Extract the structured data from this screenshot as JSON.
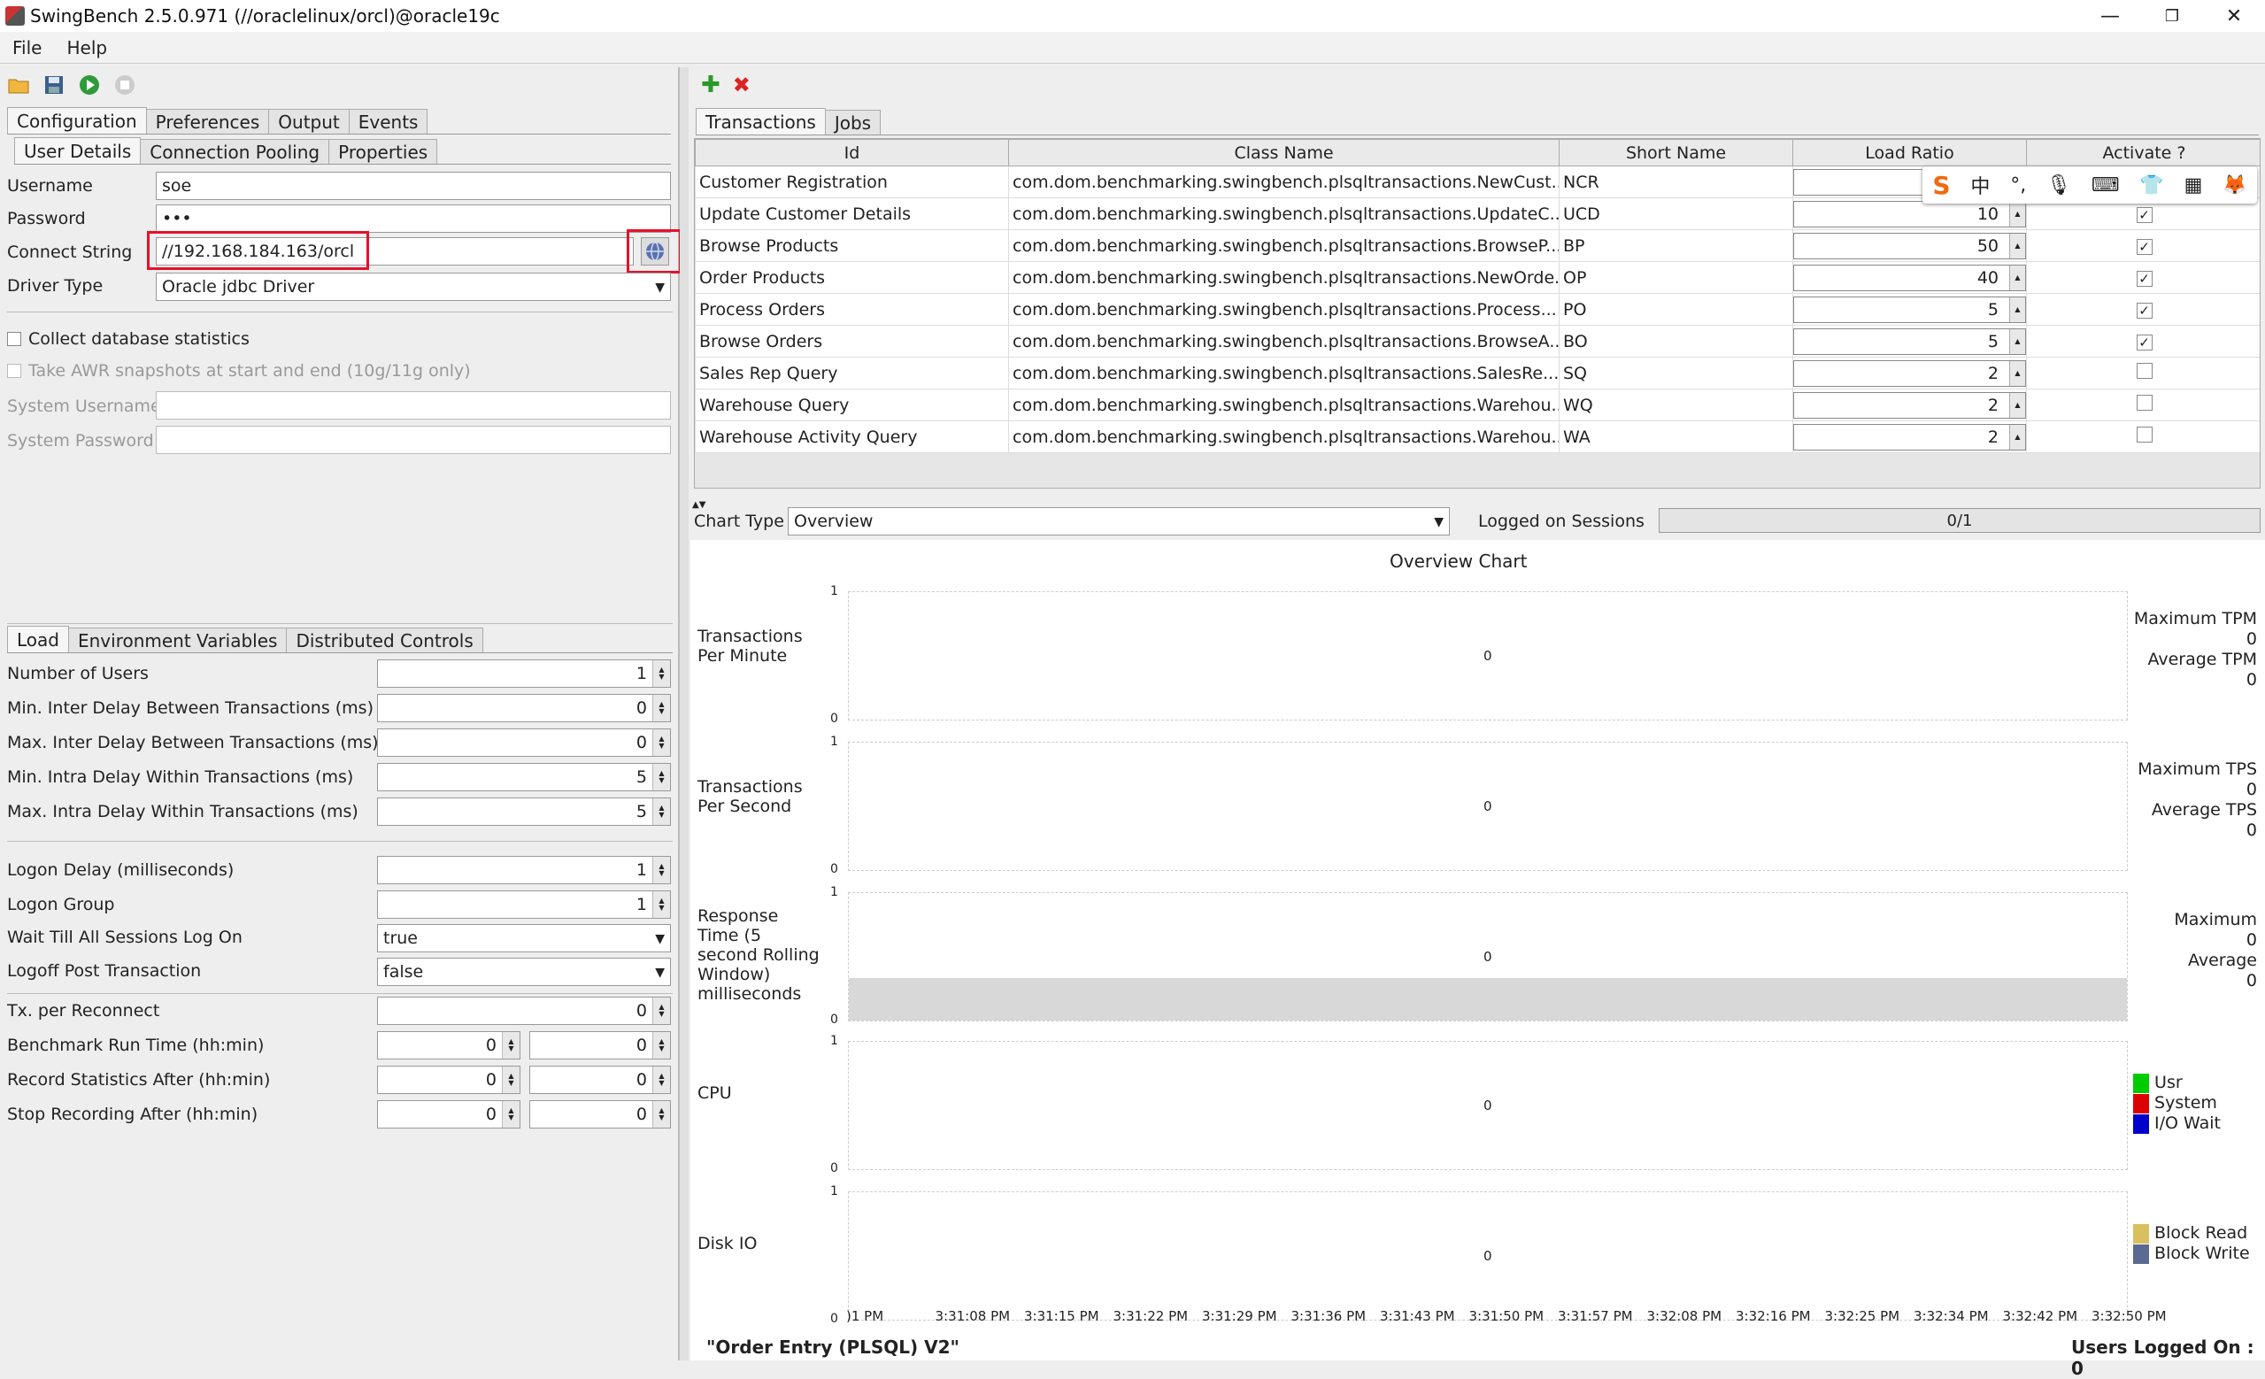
{
  "window": {
    "title": "SwingBench 2.5.0.971  (//oraclelinux/orcl)@oracle19c",
    "minimize": "—",
    "restore": "❐",
    "close": "✕"
  },
  "menu": [
    "File",
    "Help"
  ],
  "left": {
    "tabs": [
      "Configuration",
      "Preferences",
      "Output",
      "Events"
    ],
    "subtabs": [
      "User Details",
      "Connection Pooling",
      "Properties"
    ],
    "username_label": "Username",
    "username": "soe",
    "password_label": "Password",
    "password": "•••",
    "connect_label": "Connect String",
    "connect": "//192.168.184.163/orcl",
    "driver_label": "Driver Type",
    "driver": "Oracle jdbc Driver",
    "collect_stats": "Collect database statistics",
    "awr": "Take AWR snapshots at start and end (10g/11g only)",
    "sys_user": "System Username",
    "sys_pass": "System Password",
    "load_tabs": [
      "Load",
      "Environment Variables",
      "Distributed Controls"
    ],
    "load": [
      {
        "label": "Number of Users",
        "value": "1"
      },
      {
        "label": "Min. Inter Delay Between Transactions (ms)",
        "value": "0"
      },
      {
        "label": "Max. Inter Delay Between Transactions (ms)",
        "value": "0"
      },
      {
        "label": "Min. Intra Delay Within Transactions (ms)",
        "value": "5"
      },
      {
        "label": "Max. Intra Delay Within Transactions (ms)",
        "value": "5"
      }
    ],
    "logon_delay_label": "Logon Delay (milliseconds)",
    "logon_delay": "1",
    "logon_group_label": "Logon Group",
    "logon_group": "1",
    "wait_label": "Wait Till All Sessions Log On",
    "wait": "true",
    "logoff_label": "Logoff Post Transaction",
    "logoff": "false",
    "tx_label": "Tx. per Reconnect",
    "tx": "0",
    "run_label": "Benchmark Run Time (hh:min)",
    "run_h": "0",
    "run_m": "0",
    "rec_label": "Record Statistics After (hh:min)",
    "rec_h": "0",
    "rec_m": "0",
    "stop_label": "Stop Recording After (hh:min)",
    "stop_h": "0",
    "stop_m": "0"
  },
  "right": {
    "tabs": [
      "Transactions",
      "Jobs"
    ],
    "columns": [
      "Id",
      "Class Name",
      "Short Name",
      "Load Ratio",
      "Activate ?"
    ],
    "rows": [
      {
        "id": "Customer Registration",
        "cls": "com.dom.benchmarking.swingbench.plsqltransactions.NewCust...",
        "short": "NCR",
        "ratio": "",
        "active": true
      },
      {
        "id": "Update Customer Details",
        "cls": "com.dom.benchmarking.swingbench.plsqltransactions.UpdateC...",
        "short": "UCD",
        "ratio": "10",
        "active": true
      },
      {
        "id": "Browse Products",
        "cls": "com.dom.benchmarking.swingbench.plsqltransactions.BrowseP...",
        "short": "BP",
        "ratio": "50",
        "active": true
      },
      {
        "id": "Order Products",
        "cls": "com.dom.benchmarking.swingbench.plsqltransactions.NewOrde...",
        "short": "OP",
        "ratio": "40",
        "active": true
      },
      {
        "id": "Process Orders",
        "cls": "com.dom.benchmarking.swingbench.plsqltransactions.Process...",
        "short": "PO",
        "ratio": "5",
        "active": true
      },
      {
        "id": "Browse Orders",
        "cls": "com.dom.benchmarking.swingbench.plsqltransactions.BrowseA...",
        "short": "BO",
        "ratio": "5",
        "active": true
      },
      {
        "id": "Sales Rep Query",
        "cls": "com.dom.benchmarking.swingbench.plsqltransactions.SalesRe...",
        "short": "SQ",
        "ratio": "2",
        "active": false
      },
      {
        "id": "Warehouse Query",
        "cls": "com.dom.benchmarking.swingbench.plsqltransactions.Warehou...",
        "short": "WQ",
        "ratio": "2",
        "active": false
      },
      {
        "id": "Warehouse Activity Query",
        "cls": "com.dom.benchmarking.swingbench.plsqltransactions.Warehou...",
        "short": "WA",
        "ratio": "2",
        "active": false
      }
    ],
    "chart_type_label": "Chart Type",
    "chart_type": "Overview",
    "sessions_label": "Logged on Sessions",
    "sessions": "0/1",
    "chart_title": "Overview Chart",
    "charts": [
      {
        "label": "Transactions\nPer Minute",
        "s1": "Maximum TPM",
        "v1": "0",
        "s2": "Average TPM",
        "v2": "0"
      },
      {
        "label": "Transactions\nPer Second",
        "s1": "Maximum TPS",
        "v1": "0",
        "s2": "Average TPS",
        "v2": "0"
      },
      {
        "label": "Response\nTime (5\nsecond Rolling\nWindow)\nmilliseconds",
        "s1": "Maximum",
        "v1": "0",
        "s2": "Average",
        "v2": "0"
      },
      {
        "label": "CPU",
        "legend": [
          "Usr",
          "System",
          "I/O Wait"
        ]
      },
      {
        "label": "Disk IO",
        "legend": [
          "Block Read",
          "Block Write"
        ]
      }
    ],
    "times": [
      ")1 PM",
      "3:31:08 PM",
      "3:31:15 PM",
      "3:31:22 PM",
      "3:31:29 PM",
      "3:31:36 PM",
      "3:31:43 PM",
      "3:31:50 PM",
      "3:31:57 PM",
      "3:32:08 PM",
      "3:32:16 PM",
      "3:32:25 PM",
      "3:32:34 PM",
      "3:32:42 PM",
      "3:32:50 PM"
    ],
    "benchmark": "\"Order Entry (PLSQL) V2\"",
    "users_logged": "Users Logged On : 0"
  },
  "colors": {
    "usr": "#00cc00",
    "system": "#dd0000",
    "iowait": "#0000cc",
    "blockread": "#d8c060",
    "blockwrite": "#5a6a90",
    "highlight": "#e8102a"
  }
}
